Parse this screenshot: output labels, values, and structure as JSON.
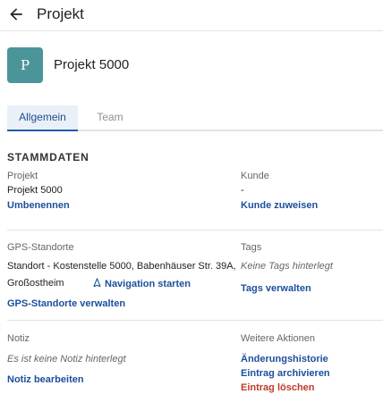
{
  "header": {
    "title": "Projekt"
  },
  "project": {
    "avatar_letter": "P",
    "name": "Projekt 5000"
  },
  "tabs": [
    {
      "label": "Allgemein",
      "active": true
    },
    {
      "label": "Team",
      "active": false
    }
  ],
  "stammdaten": {
    "title": "STAMMDATEN",
    "projekt_label": "Projekt",
    "projekt_value": "Projekt 5000",
    "rename_link": "Umbenennen",
    "kunde_label": "Kunde",
    "kunde_value": "-",
    "kunde_link": "Kunde zuweisen"
  },
  "gps": {
    "label": "GPS-Standorte",
    "address_line1": "Standort - Kostenstelle 5000, Babenhäuser Str. 39A,",
    "address_line2": "Großostheim",
    "navigation_link": "Navigation starten",
    "manage_link": "GPS-Standorte verwalten"
  },
  "tags": {
    "label": "Tags",
    "empty_text": "Keine Tags hinterlegt",
    "manage_link": "Tags verwalten"
  },
  "notiz": {
    "label": "Notiz",
    "empty_text": "Es ist keine Notiz hinterlegt",
    "edit_link": "Notiz bearbeiten"
  },
  "actions": {
    "label": "Weitere Aktionen",
    "history": "Änderungshistorie",
    "archive": "Eintrag archivieren",
    "delete": "Eintrag löschen"
  },
  "colors": {
    "accent": "#1b4f9c",
    "avatar": "#4b959a",
    "danger": "#c0392b"
  }
}
